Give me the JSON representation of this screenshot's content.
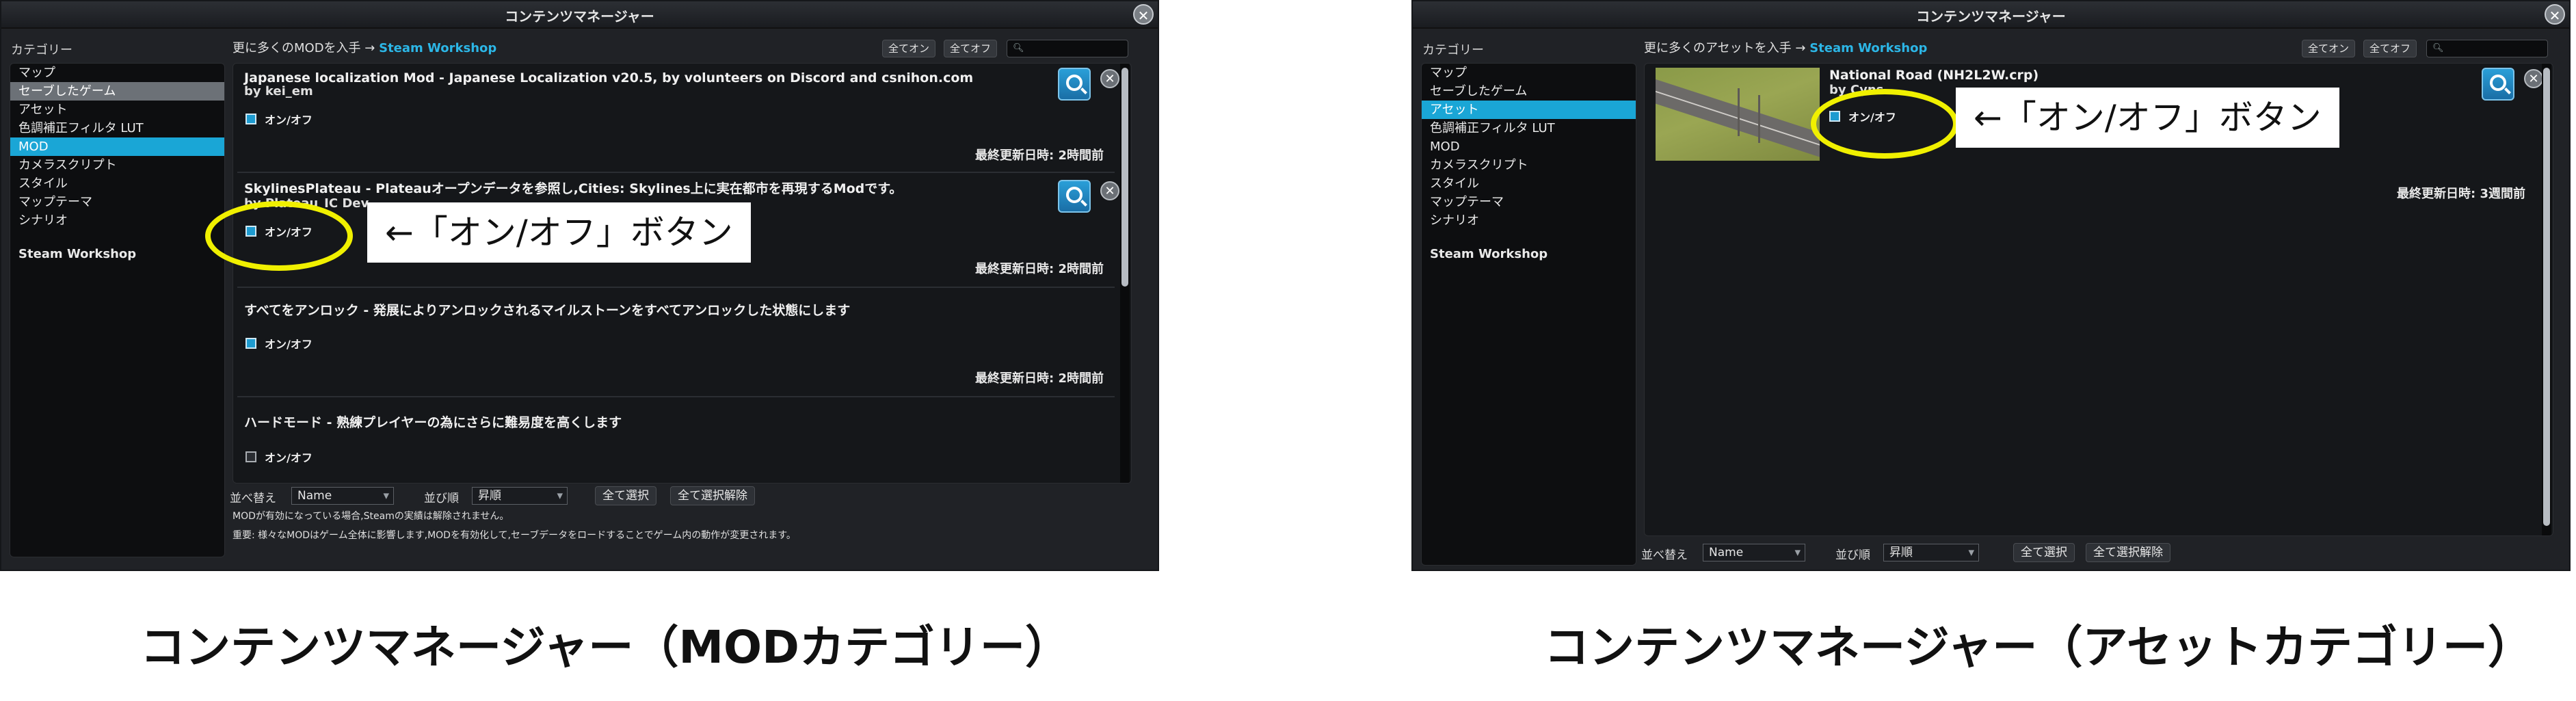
{
  "mod_panel": {
    "title": "コンテンツマネージャー",
    "category_label": "カテゴリー",
    "categories": [
      {
        "label": "マップ",
        "state": "normal"
      },
      {
        "label": "セーブしたゲーム",
        "state": "hover"
      },
      {
        "label": "アセット",
        "state": "normal"
      },
      {
        "label": "色調補正フィルタ LUT",
        "state": "normal"
      },
      {
        "label": "MOD",
        "state": "selected"
      },
      {
        "label": "カメラスクリプト",
        "state": "normal"
      },
      {
        "label": "スタイル",
        "state": "normal"
      },
      {
        "label": "マップテーマ",
        "state": "normal"
      },
      {
        "label": "シナリオ",
        "state": "normal"
      }
    ],
    "steam_workshop_item": "Steam Workshop",
    "get_more_text": "更に多くのMODを入手 →",
    "get_more_link": "Steam Workshop",
    "all_on": "全てオン",
    "all_off": "全てオフ",
    "entries": [
      {
        "title": "Japanese localization Mod - Japanese Localization v20.5, by volunteers on Discord and csnihon.com",
        "by": "by kei_em",
        "toggle_label": "オン/オフ",
        "enabled": true,
        "updated": "最終更新日時: 2時間前"
      },
      {
        "title": "SkylinesPlateau - Plateauオープンデータを参照し,Cities: Skylines上に実在都市を再現するModです。",
        "by": "by Plateau_IC Dev",
        "toggle_label": "オン/オフ",
        "enabled": true,
        "updated": "最終更新日時: 2時間前"
      },
      {
        "title": "すべてをアンロック - 発展によりアンロックされるマイルストーンをすべてアンロックした状態にします",
        "toggle_label": "オン/オフ",
        "enabled": true,
        "updated": "最終更新日時: 2時間前"
      },
      {
        "title": "ハードモード - 熟練プレイヤーの為にさらに難易度を高くします",
        "toggle_label": "オン/オフ",
        "enabled": false
      }
    ],
    "sort_label": "並べ替え",
    "sort_value": "Name",
    "order_label": "並び順",
    "order_value": "昇順",
    "select_all": "全て選択",
    "deselect_all": "全て選択解除",
    "note1": "MODが有効になっている場合,Steamの実績は解除されません。",
    "note2": "重要: 様々なMODはゲーム全体に影響します,MODを有効化して,セーブデータをロードすることでゲーム内の動作が変更されます。",
    "callout": "←「オン/オフ」ボタン"
  },
  "asset_panel": {
    "title": "コンテンツマネージャー",
    "category_label": "カテゴリー",
    "categories": [
      {
        "label": "マップ",
        "state": "normal"
      },
      {
        "label": "セーブしたゲーム",
        "state": "normal"
      },
      {
        "label": "アセット",
        "state": "selected"
      },
      {
        "label": "色調補正フィルタ LUT",
        "state": "normal"
      },
      {
        "label": "MOD",
        "state": "normal"
      },
      {
        "label": "カメラスクリプト",
        "state": "normal"
      },
      {
        "label": "スタイル",
        "state": "normal"
      },
      {
        "label": "マップテーマ",
        "state": "normal"
      },
      {
        "label": "シナリオ",
        "state": "normal"
      }
    ],
    "steam_workshop_item": "Steam Workshop",
    "get_more_text": "更に多くのアセットを入手 →",
    "get_more_link": "Steam Workshop",
    "all_on": "全てオン",
    "all_off": "全てオフ",
    "entry": {
      "title": "National Road (NH2L2W.crp)",
      "by": "by Cyns",
      "toggle_label": "オン/オフ",
      "enabled": true,
      "updated": "最終更新日時: 3週間前"
    },
    "sort_label": "並べ替え",
    "sort_value": "Name",
    "order_label": "並び順",
    "order_value": "昇順",
    "select_all": "全て選択",
    "deselect_all": "全て選択解除",
    "callout": "←「オン/オフ」ボタン"
  },
  "captions": {
    "left": "コンテンツマネージャー（MODカテゴリー）",
    "right": "コンテンツマネージャー（アセットカテゴリー）"
  },
  "colors": {
    "accent": "#1aa6d6",
    "callout_ring": "#f0f000",
    "panel_bg": "#202226"
  },
  "icons": [
    "close-icon",
    "magnifier-icon",
    "remove-icon",
    "checkbox-icon",
    "dropdown-arrow-icon"
  ]
}
